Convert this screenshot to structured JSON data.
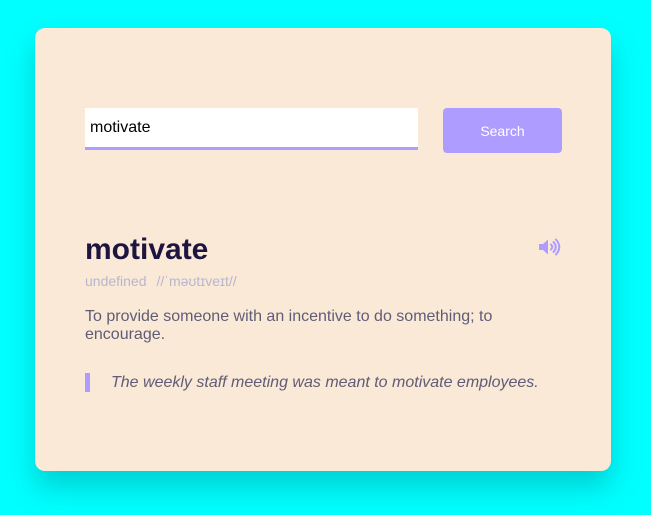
{
  "search": {
    "value": "motivate",
    "button_label": "Search"
  },
  "result": {
    "word": "motivate",
    "part_of_speech": "undefined",
    "phonetic": "//ˈməʊtɪveɪt//",
    "definition": "To provide someone with an incentive to do something; to encourage.",
    "example": "The weekly staff meeting was meant to motivate employees.",
    "sound_icon": "speaker-volume-icon"
  },
  "colors": {
    "page_background": "#00ffff",
    "card_background": "#f9e9d6",
    "accent": "#ae9cff",
    "word_title": "#1d1540",
    "phonetic_text": "#b9b5cf",
    "body_text": "#605c76"
  }
}
